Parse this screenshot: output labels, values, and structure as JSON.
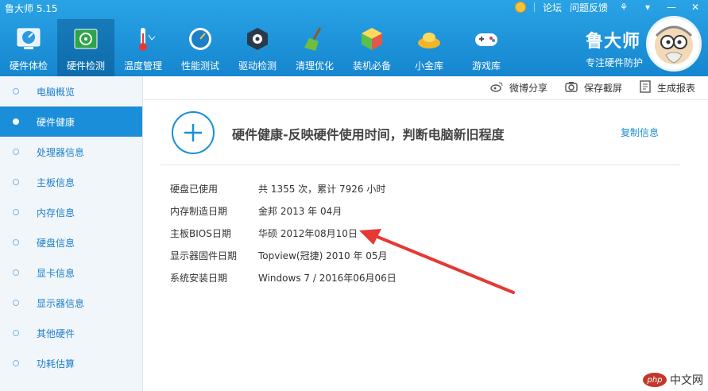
{
  "app": {
    "title": "鲁大师 5.15"
  },
  "window": {
    "forum": "论坛",
    "feedback": "问题反馈"
  },
  "toolbar": {
    "items": [
      {
        "label": "硬件体检",
        "icon": "speedometer-icon"
      },
      {
        "label": "硬件检测",
        "icon": "circuit-board-icon"
      },
      {
        "label": "温度管理",
        "icon": "thermometer-icon"
      },
      {
        "label": "性能测试",
        "icon": "gauge-icon"
      },
      {
        "label": "驱动检测",
        "icon": "gear-box-icon"
      },
      {
        "label": "清理优化",
        "icon": "broom-icon"
      },
      {
        "label": "装机必备",
        "icon": "cube-box-icon"
      },
      {
        "label": "小金库",
        "icon": "gold-ingot-icon"
      },
      {
        "label": "游戏库",
        "icon": "gamepad-icon"
      }
    ]
  },
  "brand": {
    "name": "鲁大师",
    "slogan": "专注硬件防护"
  },
  "sidebar": {
    "items": [
      {
        "label": "电脑概览"
      },
      {
        "label": "硬件健康"
      },
      {
        "label": "处理器信息"
      },
      {
        "label": "主板信息"
      },
      {
        "label": "内存信息"
      },
      {
        "label": "硬盘信息"
      },
      {
        "label": "显卡信息"
      },
      {
        "label": "显示器信息"
      },
      {
        "label": "其他硬件"
      },
      {
        "label": "功耗估算"
      }
    ]
  },
  "actions": {
    "share": "微博分享",
    "screenshot": "保存截屏",
    "report": "生成报表"
  },
  "main": {
    "heading": "硬件健康-反映硬件使用时间，判断电脑新旧程度",
    "copy_info": "复制信息",
    "rows": [
      {
        "key": "硬盘已使用",
        "value": "共 1355 次，累计 7926 小时"
      },
      {
        "key": "内存制造日期",
        "value": "金邦 2013 年 04月"
      },
      {
        "key": "主板BIOS日期",
        "value": "华硕 2012年08月10日"
      },
      {
        "key": "显示器固件日期",
        "value": "Topview(冠捷) 2010 年 05月"
      },
      {
        "key": "系统安装日期",
        "value": "Windows 7 / 2016年06月06日"
      }
    ]
  },
  "watermark": {
    "logo": "php",
    "text": "中文网"
  },
  "colors": {
    "accent": "#1a8ed9",
    "arrow": "#e53935"
  }
}
